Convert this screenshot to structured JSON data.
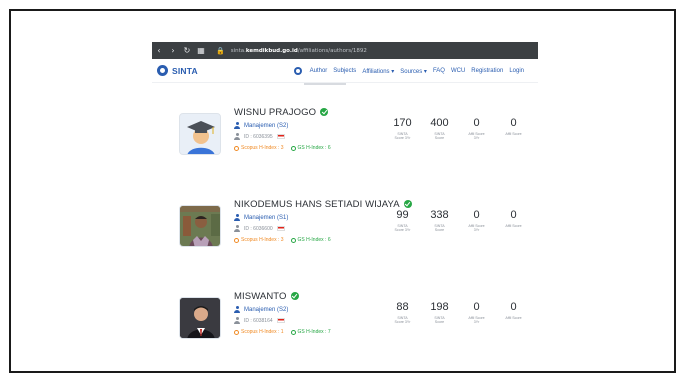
{
  "browser": {
    "url_prefix": "sinta.",
    "url_domain": "kemdikbud.go.id",
    "url_path": "/affiliations/authors/1892"
  },
  "site": {
    "logo_text": "SINTA",
    "menu": [
      {
        "label": "Author"
      },
      {
        "label": "Subjects"
      },
      {
        "label": "Affiliations ▾"
      },
      {
        "label": "Sources ▾"
      },
      {
        "label": "FAQ"
      },
      {
        "label": "WCU"
      },
      {
        "label": "Registration"
      },
      {
        "label": "Login"
      }
    ]
  },
  "authors": [
    {
      "name": "WISNU PRAJOGO",
      "dept": "Manajemen (S2)",
      "id_text": "ID : 6036395",
      "scopus": "Scopus H-Index : 3",
      "gs": "GS H-Index : 6",
      "stats": [
        {
          "value": "170",
          "label": "SINTA\nScore 3Yr"
        },
        {
          "value": "400",
          "label": "SINTA\nScore"
        },
        {
          "value": "0",
          "label": "Affil Score\n3Yr"
        },
        {
          "value": "0",
          "label": "Affil Score"
        }
      ]
    },
    {
      "name": "NIKODEMUS HANS SETIADI WIJAYA",
      "dept": "Manajemen (S1)",
      "id_text": "ID : 6036600",
      "scopus": "Scopus H-Index : 3",
      "gs": "GS H-Index : 6",
      "stats": [
        {
          "value": "99",
          "label": "SINTA\nScore 3Yr"
        },
        {
          "value": "338",
          "label": "SINTA\nScore"
        },
        {
          "value": "0",
          "label": "Affil Score\n3Yr"
        },
        {
          "value": "0",
          "label": "Affil Score"
        }
      ]
    },
    {
      "name": "MISWANTO",
      "dept": "Manajemen (S2)",
      "id_text": "ID : 6038164",
      "scopus": "Scopus H-Index : 1",
      "gs": "GS H-Index : 7",
      "stats": [
        {
          "value": "88",
          "label": "SINTA\nScore 3Yr"
        },
        {
          "value": "198",
          "label": "SINTA\nScore"
        },
        {
          "value": "0",
          "label": "Affil Score\n3Yr"
        },
        {
          "value": "0",
          "label": "Affil Score"
        }
      ]
    }
  ],
  "colors": {
    "brand": "#2a5db0",
    "verified": "#27a745",
    "scopus": "#f08a24",
    "gs": "#27a745"
  }
}
